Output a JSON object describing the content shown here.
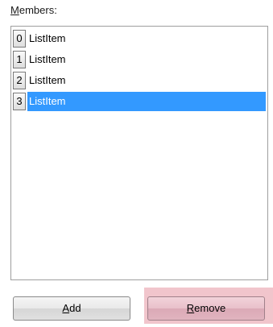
{
  "members": {
    "label_mnemonic": "M",
    "label_rest": "embers:"
  },
  "list": {
    "items": [
      {
        "index": "0",
        "text": "ListItem",
        "selected": false
      },
      {
        "index": "1",
        "text": "ListItem",
        "selected": false
      },
      {
        "index": "2",
        "text": "ListItem",
        "selected": false
      },
      {
        "index": "3",
        "text": "ListItem",
        "selected": true
      }
    ],
    "selection_color": "#3399ff"
  },
  "buttons": {
    "add_mnemonic": "A",
    "add_rest": "dd",
    "remove_mnemonic": "R",
    "remove_rest": "emove",
    "remove_highlight_color": "#f1c5cc"
  }
}
